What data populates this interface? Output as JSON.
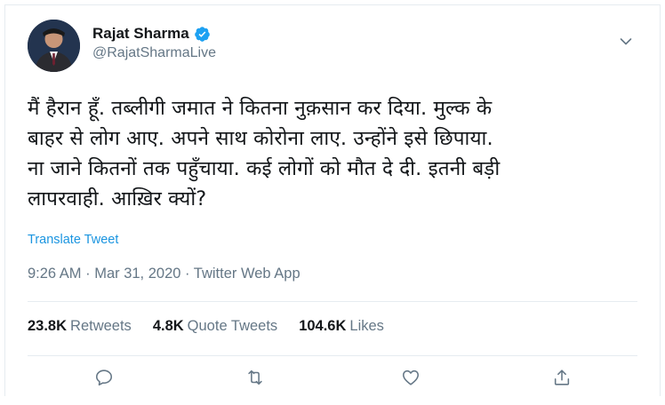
{
  "user": {
    "display_name": "Rajat Sharma",
    "handle": "@RajatSharmaLive",
    "verified": true
  },
  "tweet": {
    "lines": [
      "मैं हैरान हूँ. तब्लीगी जमात ने कितना नुक़सान कर दिया. मुल्क के",
      "बाहर से लोग आए. अपने साथ कोरोना लाए. उन्होंने इसे छिपाया.",
      "ना जाने कितनों तक पहुँचाया. कई लोगों को मौत दे दी. इतनी बड़ी",
      "लापरवाही. आख़िर क्यों?"
    ],
    "translate_label": "Translate Tweet",
    "timestamp": "9:26 AM · Mar 31, 2020 · Twitter Web App"
  },
  "stats": {
    "retweets_count": "23.8K",
    "retweets_label": "Retweets",
    "quote_count": "4.8K",
    "quote_label": "Quote Tweets",
    "likes_count": "104.6K",
    "likes_label": "Likes"
  },
  "colors": {
    "link": "#1b95e0",
    "muted": "#657786",
    "text": "#14171a",
    "verified": "#1da1f2"
  },
  "icons": {
    "reply": "reply-icon",
    "retweet": "retweet-icon",
    "like": "like-icon",
    "share": "share-icon",
    "caret": "chevron-down-icon",
    "verified": "verified-badge-icon"
  }
}
